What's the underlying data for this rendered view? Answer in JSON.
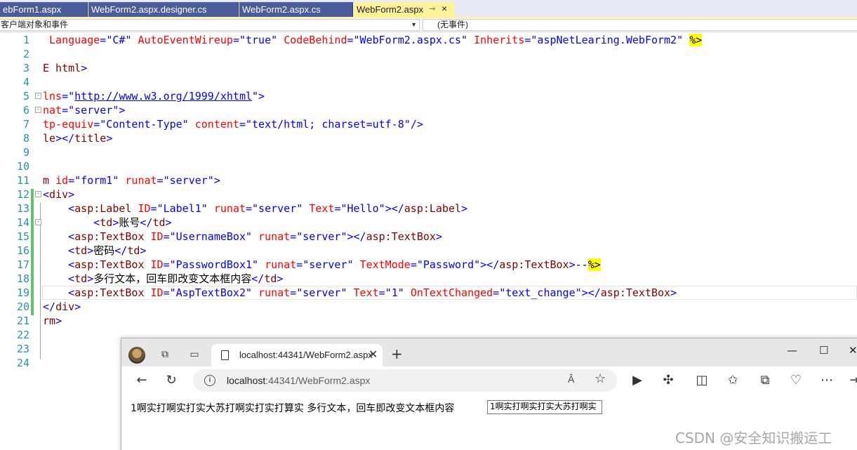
{
  "vs": {
    "tabs": [
      {
        "label": "ebForm1.aspx"
      },
      {
        "label": "WebForm2.aspx.designer.cs"
      },
      {
        "label": "WebForm2.aspx.cs"
      },
      {
        "label": "WebForm2.aspx",
        "active": true
      }
    ],
    "nav_left": "客户端对象和事件",
    "nav_right": "(无事件)"
  },
  "editor": {
    "lines": [
      {
        "n": "1",
        "code": " Language=\"C#\" AutoEventWireup=\"true\" CodeBehind=\"WebForm2.aspx.cs\" Inherits=\"aspNetLearing.WebForm2\" %>"
      },
      {
        "n": "2",
        "code": ""
      },
      {
        "n": "3",
        "code": "E html>"
      },
      {
        "n": "4",
        "code": ""
      },
      {
        "n": "5",
        "code": "lns=\"http://www.w3.org/1999/xhtml\">"
      },
      {
        "n": "6",
        "code": "nat=\"server\">"
      },
      {
        "n": "7",
        "code": "tp-equiv=\"Content-Type\" content=\"text/html; charset=utf-8\"/>"
      },
      {
        "n": "8",
        "code": "le></title>"
      },
      {
        "n": "9",
        "code": ""
      },
      {
        "n": "10",
        "code": ""
      },
      {
        "n": "11",
        "code": "m id=\"form1\" runat=\"server\">"
      },
      {
        "n": "12",
        "code": "<div>"
      },
      {
        "n": "13",
        "code": "    <asp:Label ID=\"Label1\" runat=\"server\" Text=\"Hello\"></asp:Label>"
      },
      {
        "n": "14",
        "code": "        <td>账号</td>"
      },
      {
        "n": "15",
        "code": "    <asp:TextBox ID=\"UsernameBox\" runat=\"server\"></asp:TextBox>"
      },
      {
        "n": "16",
        "code": "    <td>密码</td>"
      },
      {
        "n": "17",
        "code": "    <asp:TextBox ID=\"PasswordBox1\" runat=\"server\" TextMode=\"Password\"></asp:TextBox>--%>"
      },
      {
        "n": "18",
        "code": "    <td>多行文本，回车即改变文本框内容</td>"
      },
      {
        "n": "19",
        "code": "    <asp:TextBox ID=\"AspTextBox2\" runat=\"server\" Text=\"1\" OnTextChanged=\"text_change\"></asp:TextBox>"
      },
      {
        "n": "20",
        "code": "</div>"
      },
      {
        "n": "21",
        "code": "rm>"
      },
      {
        "n": "22",
        "code": ""
      },
      {
        "n": "23",
        "code": ""
      },
      {
        "n": "24",
        "code": ""
      }
    ]
  },
  "browser": {
    "tab_title": "localhost:44341/WebForm2.aspx",
    "url_host": "localhost",
    "url_rest": ":44341/WebForm2.aspx",
    "page_text": "1啊实打啊实打实大苏打啊实打实打算实 多行文本，回车即改变文本框内容",
    "textbox_value": "1啊实打啊实打实大苏打啊实",
    "read_aloud": "Â"
  },
  "watermark": "CSDN @安全知识搬运工",
  "colors": {
    "tab_inactive": "#4a5c99",
    "tab_active": "#fff29d",
    "line_number": "#2b91af",
    "tag": "#800000",
    "attribute": "#ff0000",
    "value": "#0000ff",
    "change_bar": "#5fc36b"
  }
}
